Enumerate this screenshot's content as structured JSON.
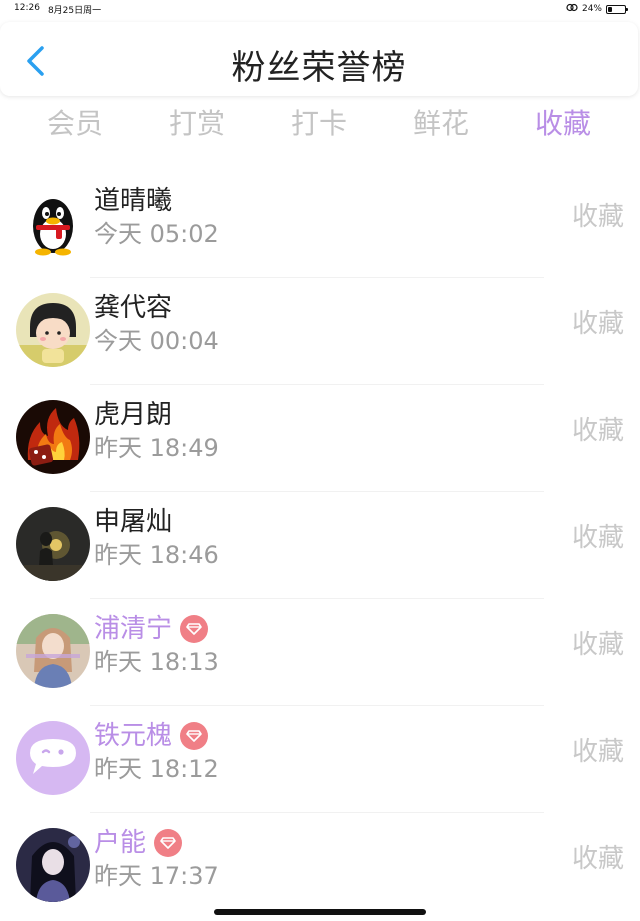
{
  "status": {
    "time": "12:26",
    "date": "8月25日周一",
    "battery": "24%",
    "battery_level": 0.24
  },
  "header": {
    "title": "粉丝荣誉榜"
  },
  "tabs": [
    {
      "label": "会员",
      "active": false
    },
    {
      "label": "打赏",
      "active": false
    },
    {
      "label": "打卡",
      "active": false
    },
    {
      "label": "鲜花",
      "active": false
    },
    {
      "label": "收藏",
      "active": true
    }
  ],
  "colors": {
    "accent": "#b98ee6",
    "vip_badge": "#f07f86",
    "back_arrow": "#2aa0f0"
  },
  "fans": [
    {
      "name": "道晴曦",
      "time": "今天 05:02",
      "action": "收藏",
      "vip": false,
      "avatar": "qq-penguin"
    },
    {
      "name": "龚代容",
      "time": "今天 00:04",
      "action": "收藏",
      "vip": false,
      "avatar": "cartoon-girl"
    },
    {
      "name": "虎月朗",
      "time": "昨天 18:49",
      "action": "收藏",
      "vip": false,
      "avatar": "fire"
    },
    {
      "name": "申屠灿",
      "time": "昨天 18:46",
      "action": "收藏",
      "vip": false,
      "avatar": "night-figure"
    },
    {
      "name": "浦清宁",
      "time": "昨天 18:13",
      "action": "收藏",
      "vip": true,
      "avatar": "girl-photo"
    },
    {
      "name": "铁元槐",
      "time": "昨天 18:12",
      "action": "收藏",
      "vip": true,
      "avatar": "chat-bubble"
    },
    {
      "name": "户能",
      "time": "昨天 17:37",
      "action": "收藏",
      "vip": true,
      "avatar": "girl-dark"
    }
  ]
}
